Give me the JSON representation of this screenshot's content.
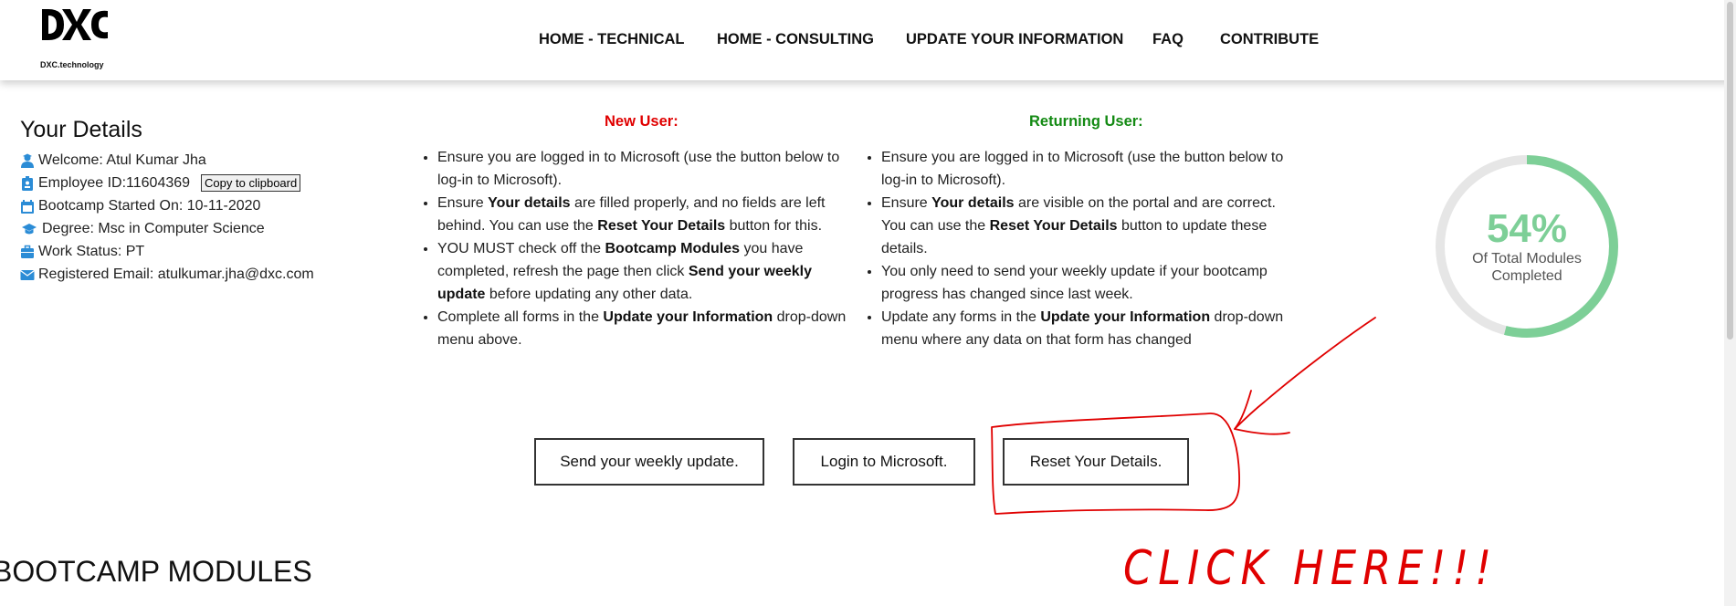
{
  "header": {
    "logo_caption": "DXC.technology",
    "nav": [
      "HOME - TECHNICAL",
      "HOME - CONSULTING",
      "UPDATE YOUR INFORMATION",
      "FAQ",
      "CONTRIBUTE"
    ]
  },
  "details": {
    "title": "Your Details",
    "welcome": "Welcome: Atul Kumar Jha",
    "employee_id": "Employee ID:11604369",
    "copy_button": "Copy to clipboard",
    "bootcamp_started": "Bootcamp Started On: 10-11-2020",
    "degree": "Degree: Msc in Computer Science",
    "work_status": "Work Status: PT",
    "email": "Registered Email: atulkumar.jha@dxc.com"
  },
  "new_user": {
    "heading": "New User:",
    "items": [
      [
        "Ensure you are logged in to Microsoft (use the button below to log-in to Microsoft)."
      ],
      [
        "Ensure ",
        "Your details",
        " are filled properly, and no fields are left behind. You can use the ",
        "Reset Your Details",
        " button for this."
      ],
      [
        "YOU MUST check off the ",
        "Bootcamp Modules",
        " you have completed, refresh the page then click ",
        "Send your weekly update",
        " before updating any other data."
      ],
      [
        "Complete all forms in the ",
        "Update your Information",
        " drop-down menu above."
      ]
    ]
  },
  "returning_user": {
    "heading": "Returning User:",
    "items": [
      [
        "Ensure you are logged in to Microsoft (use the button below to log-in to Microsoft)."
      ],
      [
        "Ensure ",
        "Your details",
        " are visible on the portal and are correct. You can use the ",
        "Reset Your Details",
        " button to update these details."
      ],
      [
        "You only need to send your weekly update if your bootcamp progress has changed since last week."
      ],
      [
        "Update any forms in the ",
        "Update your Information",
        " drop-down menu where any data on that form has changed"
      ]
    ]
  },
  "buttons": {
    "send": "Send your weekly update.",
    "login": "Login to Microsoft.",
    "reset": "Reset Your Details."
  },
  "progress": {
    "percent_text": "54%",
    "fraction": 0.54,
    "label": "Of Total Modules Completed",
    "color": "#7dcf97",
    "track_color": "#e6e6e6"
  },
  "section_title": "BOOTCAMP MODULES",
  "annotation": {
    "text": "CLICK HERE!!!",
    "color": "#e00000"
  },
  "colors": {
    "new_user": "#e00000",
    "returning_user": "#138a13",
    "icon": "#2b8cd6"
  }
}
